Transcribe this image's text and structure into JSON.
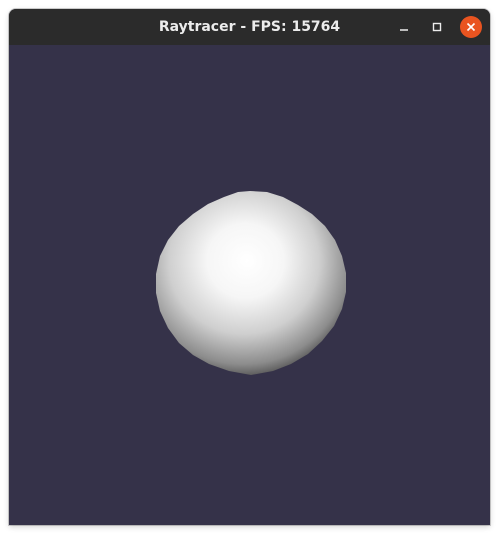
{
  "window": {
    "title": "Raytracer - FPS: 15764",
    "controls": {
      "minimize": "minimize-icon",
      "maximize": "maximize-icon",
      "close": "close-icon"
    }
  },
  "viewport": {
    "scene": "sphere",
    "colors": {
      "background": "#353249",
      "sphere_highlight": "#ffffff",
      "sphere_shadow": "#1a1a1a",
      "titlebar": "#2b2b2b",
      "close_button": "#e95420"
    }
  }
}
